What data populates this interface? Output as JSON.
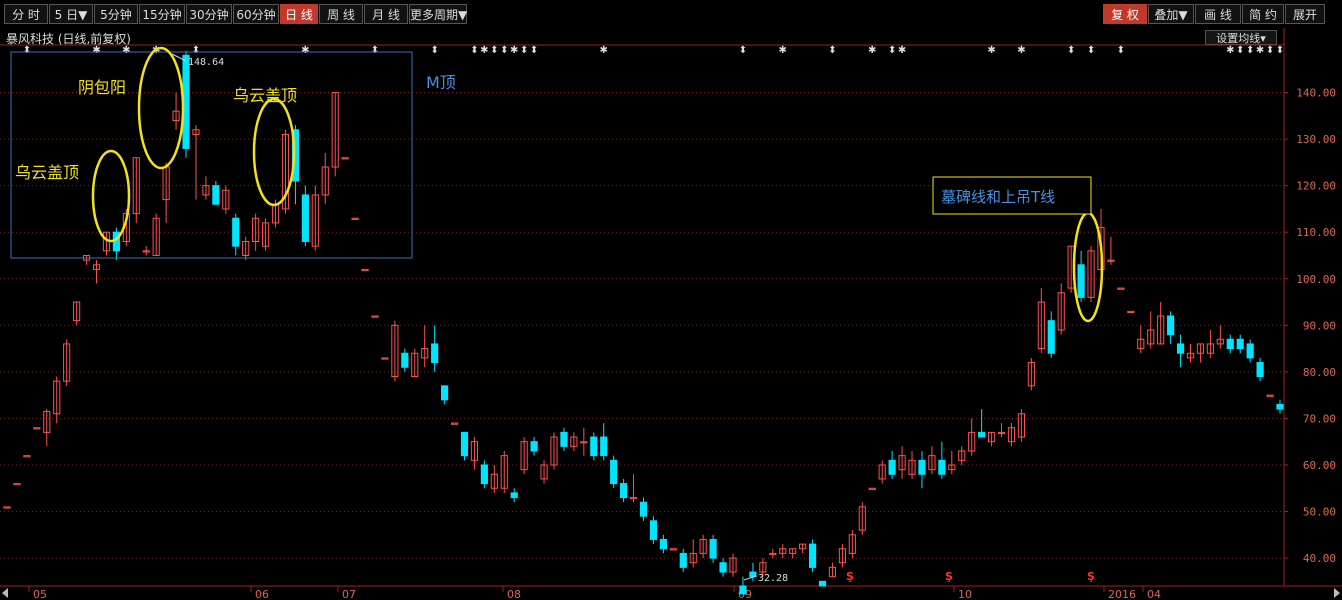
{
  "toolbar": {
    "left": [
      "分 时",
      "5 日▼",
      "5分钟",
      "15分钟",
      "30分钟",
      "60分钟",
      "日 线",
      "周 线",
      "月 线",
      "更多周期▼"
    ],
    "active": "日 线",
    "right": [
      "复 权",
      "叠加▼",
      "画 线",
      "简 约",
      "展开"
    ],
    "right_active": "复 权"
  },
  "stock_title": "暴风科技 (日线,前复权)",
  "ma_button": "设置均线▾",
  "colors": {
    "up": "#ff5050",
    "down": "#00e5ff",
    "grid": "#7a1f1f",
    "annotation": "#f2e21a",
    "box": "#3d6fb5",
    "mtop": "#4a8fe0"
  },
  "annotations": {
    "m_top": "M顶",
    "wu_yun_1": "乌云盖顶",
    "yin_bao_yang": "阴包阳",
    "wu_yun_2": "乌云盖顶",
    "tombstone": "墓碑线和上吊T线",
    "high_label": "148.64",
    "low_label": "32.28"
  },
  "chart_data": {
    "type": "candlestick",
    "title": "暴风科技 (日线,前复权)",
    "ylim": [
      35,
      150
    ],
    "yticks": [
      40,
      50,
      60,
      70,
      80,
      90,
      100,
      110,
      120,
      130,
      140
    ],
    "ytick_labels": [
      "40.00",
      "50.00",
      "60.00",
      "70.00",
      "80.00",
      "90.00",
      "100.00",
      "110.00",
      "120.00",
      "130.00",
      "140.00"
    ],
    "xtick_labels": [
      "05",
      "06",
      "07",
      "08",
      "09",
      "10",
      "2016",
      "04"
    ],
    "grid": true,
    "highest": 148.64,
    "lowest": 32.28,
    "candles": [
      [
        51,
        51,
        51,
        51
      ],
      [
        56,
        56,
        56,
        56
      ],
      [
        62,
        62,
        62,
        62
      ],
      [
        68,
        68,
        68,
        68
      ],
      [
        67,
        71.5,
        64,
        72
      ],
      [
        71,
        78,
        69,
        79
      ],
      [
        78,
        86,
        77,
        87
      ],
      [
        91,
        95,
        90,
        95
      ],
      [
        104,
        105,
        103,
        105
      ],
      [
        102,
        103,
        99,
        104
      ],
      [
        106,
        110,
        105,
        110
      ],
      [
        110,
        106,
        104,
        111
      ],
      [
        108,
        114,
        107,
        115
      ],
      [
        114,
        126,
        112,
        126
      ],
      [
        106,
        106,
        105,
        107
      ],
      [
        105,
        113,
        105,
        114
      ],
      [
        117,
        124,
        112,
        125
      ],
      [
        134,
        136,
        132,
        140
      ],
      [
        148,
        128,
        126,
        149
      ],
      [
        131,
        132,
        117,
        133
      ],
      [
        118,
        120,
        117,
        122
      ],
      [
        120,
        116,
        116,
        121
      ],
      [
        115,
        119,
        114,
        120
      ],
      [
        113,
        107,
        105,
        114
      ],
      [
        105,
        108,
        104,
        109
      ],
      [
        108,
        113,
        106,
        114
      ],
      [
        107,
        112,
        106,
        113
      ],
      [
        112,
        116,
        111,
        117
      ],
      [
        115,
        131,
        114,
        132
      ],
      [
        132,
        121,
        116,
        133
      ],
      [
        118,
        108,
        107,
        120
      ],
      [
        107,
        118,
        106,
        120
      ],
      [
        118,
        124,
        116,
        127
      ],
      [
        124,
        140,
        122,
        140
      ],
      [
        126,
        126,
        126,
        126
      ],
      [
        113,
        113,
        113,
        113
      ],
      [
        102,
        102,
        102,
        102
      ],
      [
        92,
        92,
        92,
        92
      ],
      [
        83,
        83,
        83,
        83
      ],
      [
        79,
        90,
        78,
        91
      ],
      [
        84,
        81,
        80,
        85
      ],
      [
        79,
        84,
        79,
        85
      ],
      [
        83,
        85,
        81,
        90
      ],
      [
        86,
        82,
        80,
        90
      ],
      [
        77,
        74,
        73,
        77
      ],
      [
        69,
        69,
        69,
        69
      ],
      [
        67,
        62,
        61,
        67
      ],
      [
        61,
        65,
        59,
        66
      ],
      [
        60,
        56,
        55,
        61
      ],
      [
        55,
        58,
        54,
        60
      ],
      [
        55,
        62,
        54,
        63
      ],
      [
        54,
        53,
        52,
        55
      ],
      [
        59,
        65,
        58,
        66
      ],
      [
        65,
        63,
        62,
        66
      ],
      [
        57,
        60,
        56,
        61
      ],
      [
        60,
        66,
        59,
        67
      ],
      [
        67,
        64,
        63,
        68
      ],
      [
        64,
        66,
        63,
        67
      ],
      [
        65,
        65,
        62,
        68
      ],
      [
        66,
        62,
        61,
        67
      ],
      [
        66,
        62,
        61,
        69
      ],
      [
        61,
        56,
        55,
        62
      ],
      [
        56,
        53,
        52,
        57
      ],
      [
        53,
        53,
        52,
        58
      ],
      [
        52,
        49,
        48,
        53
      ],
      [
        48,
        44,
        43,
        49
      ],
      [
        44,
        42,
        41,
        45
      ],
      [
        42,
        42,
        42,
        42
      ],
      [
        41,
        38,
        37,
        42
      ],
      [
        39,
        41,
        38,
        44
      ],
      [
        41,
        44,
        40,
        45
      ],
      [
        44,
        40,
        39,
        45
      ],
      [
        39,
        37,
        36,
        40
      ],
      [
        37,
        40,
        36,
        41
      ],
      [
        34,
        32.3,
        32.3,
        36
      ],
      [
        37,
        36,
        35,
        39
      ],
      [
        37,
        39,
        36,
        40
      ],
      [
        41,
        41,
        40,
        42
      ],
      [
        41,
        42,
        40,
        43
      ],
      [
        41,
        42,
        40,
        42
      ],
      [
        42,
        43,
        41,
        43
      ],
      [
        43,
        38,
        37,
        44
      ],
      [
        35,
        34,
        34,
        35
      ],
      [
        36,
        38,
        36,
        39
      ],
      [
        39,
        42,
        38,
        43
      ],
      [
        41,
        45,
        40,
        46
      ],
      [
        46,
        51,
        45,
        52
      ],
      [
        55,
        55,
        55,
        55
      ],
      [
        57,
        60,
        56,
        61
      ],
      [
        61,
        58,
        57,
        63
      ],
      [
        59,
        62,
        57,
        64
      ],
      [
        58,
        61,
        57,
        63
      ],
      [
        61,
        58,
        55,
        63
      ],
      [
        59,
        62,
        58,
        64
      ],
      [
        61,
        58,
        57,
        65
      ],
      [
        59,
        60,
        58,
        63
      ],
      [
        61,
        63,
        60,
        64
      ],
      [
        63,
        67,
        62,
        70
      ],
      [
        67,
        66,
        66,
        72
      ],
      [
        65,
        67,
        64,
        67
      ],
      [
        67,
        67,
        66,
        69
      ],
      [
        65,
        68,
        64,
        69
      ],
      [
        66,
        71,
        65,
        72
      ],
      [
        77,
        82,
        76,
        83
      ],
      [
        85,
        95,
        84,
        98
      ],
      [
        91,
        84,
        83,
        93
      ],
      [
        89,
        97,
        88,
        99
      ],
      [
        98,
        107,
        97,
        107
      ],
      [
        103,
        96,
        95,
        106
      ],
      [
        96,
        106,
        95,
        107
      ],
      [
        102,
        111,
        101,
        115
      ],
      [
        104,
        104,
        103,
        109
      ],
      [
        98,
        98,
        98,
        98
      ],
      [
        93,
        93,
        93,
        93
      ],
      [
        85,
        87,
        84,
        90
      ],
      [
        86,
        89,
        85,
        93
      ],
      [
        86,
        92,
        86,
        95
      ],
      [
        92,
        88,
        86,
        93
      ],
      [
        86,
        84,
        81,
        88
      ],
      [
        83,
        84,
        82,
        86
      ],
      [
        84,
        86,
        82,
        86
      ],
      [
        84,
        86,
        83,
        89
      ],
      [
        86,
        87,
        85,
        90
      ],
      [
        87,
        85,
        84,
        88
      ],
      [
        87,
        85,
        84,
        88
      ],
      [
        86,
        83,
        82,
        87
      ],
      [
        82,
        79,
        78,
        83
      ],
      [
        75,
        75,
        75,
        75
      ],
      [
        73,
        72,
        71,
        74
      ]
    ]
  }
}
